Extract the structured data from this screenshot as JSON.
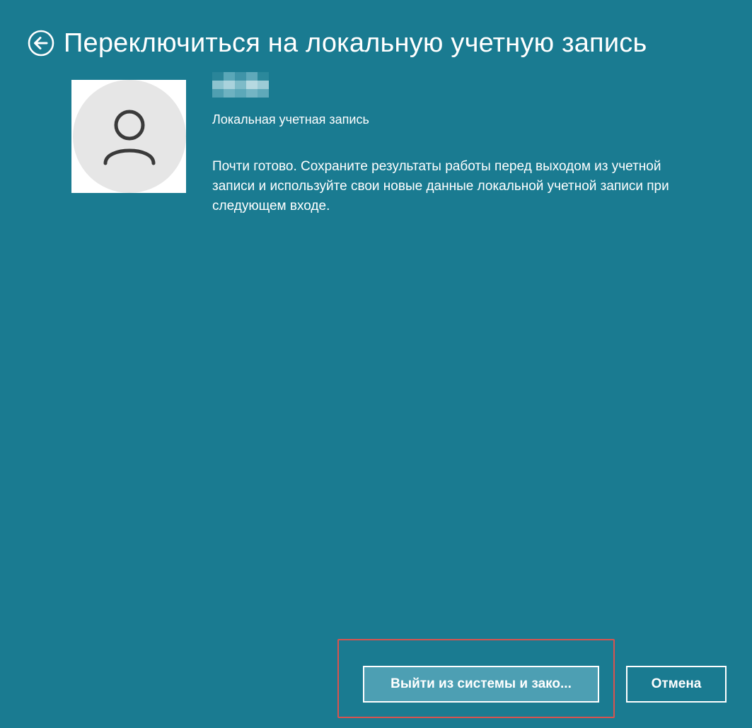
{
  "header": {
    "title": "Переключиться на локальную учетную запись",
    "back_icon": "back-arrow-circle-icon"
  },
  "account": {
    "avatar_icon": "person-icon",
    "type_label": "Локальная учетная запись"
  },
  "message": {
    "text": "Почти готово. Сохраните результаты работы перед выходом из учетной записи и используйте свои новые данные локальной учетной записи при следующем входе."
  },
  "actions": {
    "primary_label": "Выйти из системы и зако...",
    "cancel_label": "Отмена"
  },
  "colors": {
    "background": "#1a7b91",
    "primary_button": "#4d9fb3",
    "highlight_border": "#d9534f",
    "avatar_background": "#e6e6e6"
  }
}
